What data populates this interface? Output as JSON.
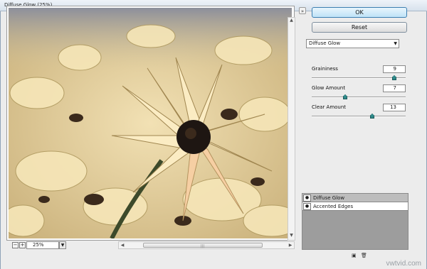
{
  "window": {
    "title": "Diffuse Glow (25%)"
  },
  "preview": {
    "zoom_value": "25%",
    "zoom_out_icon": "minus",
    "zoom_in_icon": "plus"
  },
  "buttons": {
    "ok_label": "OK",
    "reset_label": "Reset"
  },
  "filter_select": {
    "value": "Diffuse Glow"
  },
  "params": [
    {
      "label": "Graininess",
      "value": "9",
      "fraction": 0.9
    },
    {
      "label": "Glow Amount",
      "value": "7",
      "fraction": 0.35
    },
    {
      "label": "Clear Amount",
      "value": "13",
      "fraction": 0.65
    }
  ],
  "layers": [
    {
      "name": "Diffuse Glow",
      "selected": true
    },
    {
      "name": "Accented Edges",
      "selected": false
    }
  ],
  "watermark": "vwtvid.com",
  "colors": {
    "ok_accent": "#3c7fb1",
    "slider_knob": "#2f8a8a"
  }
}
